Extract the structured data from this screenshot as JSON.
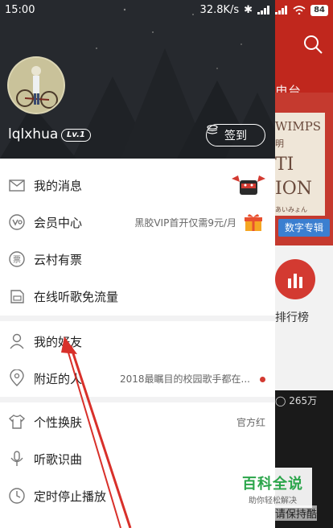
{
  "status_bar": {
    "time": "15:00",
    "speed": "32.8K/s",
    "battery": "84"
  },
  "background_app": {
    "tab_label": "电台",
    "album_lines": [
      "WIMPS",
      "明",
      "TI",
      "ION",
      "あいみょん"
    ],
    "album_tag": "数字专辑",
    "rank_label": "排行榜",
    "photo_count": "◯ 265万",
    "photo_caption": "请保持酷"
  },
  "drawer": {
    "username": "lqlxhua",
    "level": "Lv.1",
    "checkin_label": "签到",
    "menu": {
      "messages": "我的消息",
      "vip": "会员中心",
      "vip_promo": "黑胶VIP首开仅需9元/月",
      "tickets": "云村有票",
      "free_traffic": "在线听歌免流量",
      "friends": "我的好友",
      "nearby": "附近的人",
      "nearby_note": "2018最瞩目的校园歌手都在...",
      "skin": "个性换肤",
      "skin_value": "官方红",
      "recognize": "听歌识曲",
      "timer": "定时停止播放"
    }
  },
  "watermark": {
    "title": "百科全说",
    "subtitle": "助你轻松解决"
  },
  "colors": {
    "accent_red": "#d33a31",
    "header_red": "#c0271d",
    "divider": "#f2f2f3",
    "watermark_green": "#2aa54a"
  }
}
